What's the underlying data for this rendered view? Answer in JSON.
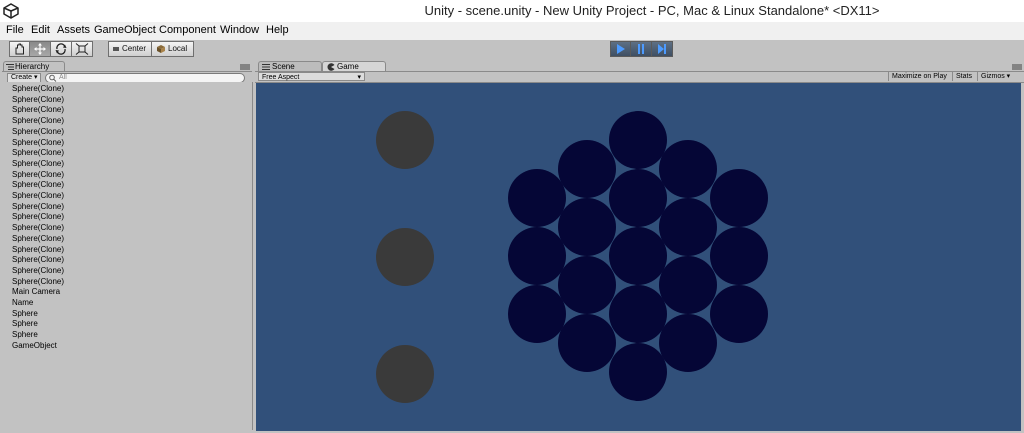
{
  "window": {
    "title": "Unity - scene.unity - New Unity Project - PC, Mac & Linux Standalone* <DX11>"
  },
  "menu": [
    "File",
    "Edit",
    "Assets",
    "GameObject",
    "Component",
    "Window",
    "Help"
  ],
  "toolbar": {
    "tools": [
      "hand-tool",
      "move-tool",
      "rotate-tool",
      "scale-tool"
    ],
    "pivot_label": "Center",
    "space_label": "Local",
    "play_controls": [
      "play",
      "pause",
      "step"
    ]
  },
  "hierarchy": {
    "tab_label": "Hierarchy",
    "create_label": "Create",
    "search_placeholder": "All",
    "items": [
      "Sphere(Clone)",
      "Sphere(Clone)",
      "Sphere(Clone)",
      "Sphere(Clone)",
      "Sphere(Clone)",
      "Sphere(Clone)",
      "Sphere(Clone)",
      "Sphere(Clone)",
      "Sphere(Clone)",
      "Sphere(Clone)",
      "Sphere(Clone)",
      "Sphere(Clone)",
      "Sphere(Clone)",
      "Sphere(Clone)",
      "Sphere(Clone)",
      "Sphere(Clone)",
      "Sphere(Clone)",
      "Sphere(Clone)",
      "Sphere(Clone)",
      "Main Camera",
      "Name",
      "Sphere",
      "Sphere",
      "Sphere",
      "GameObject"
    ]
  },
  "game_panel": {
    "tabs": [
      "Scene",
      "Game"
    ],
    "active_tab": "Game",
    "aspect_label": "Free Aspect",
    "maximize_label": "Maximize on Play",
    "stats_label": "Stats",
    "gizmos_label": "Gizmos"
  },
  "colors": {
    "viewport_bg": "#31507a",
    "sphere_gray": "#3a3a3a",
    "sphere_dark": "#050636",
    "play_active": "#4d7cc7"
  }
}
